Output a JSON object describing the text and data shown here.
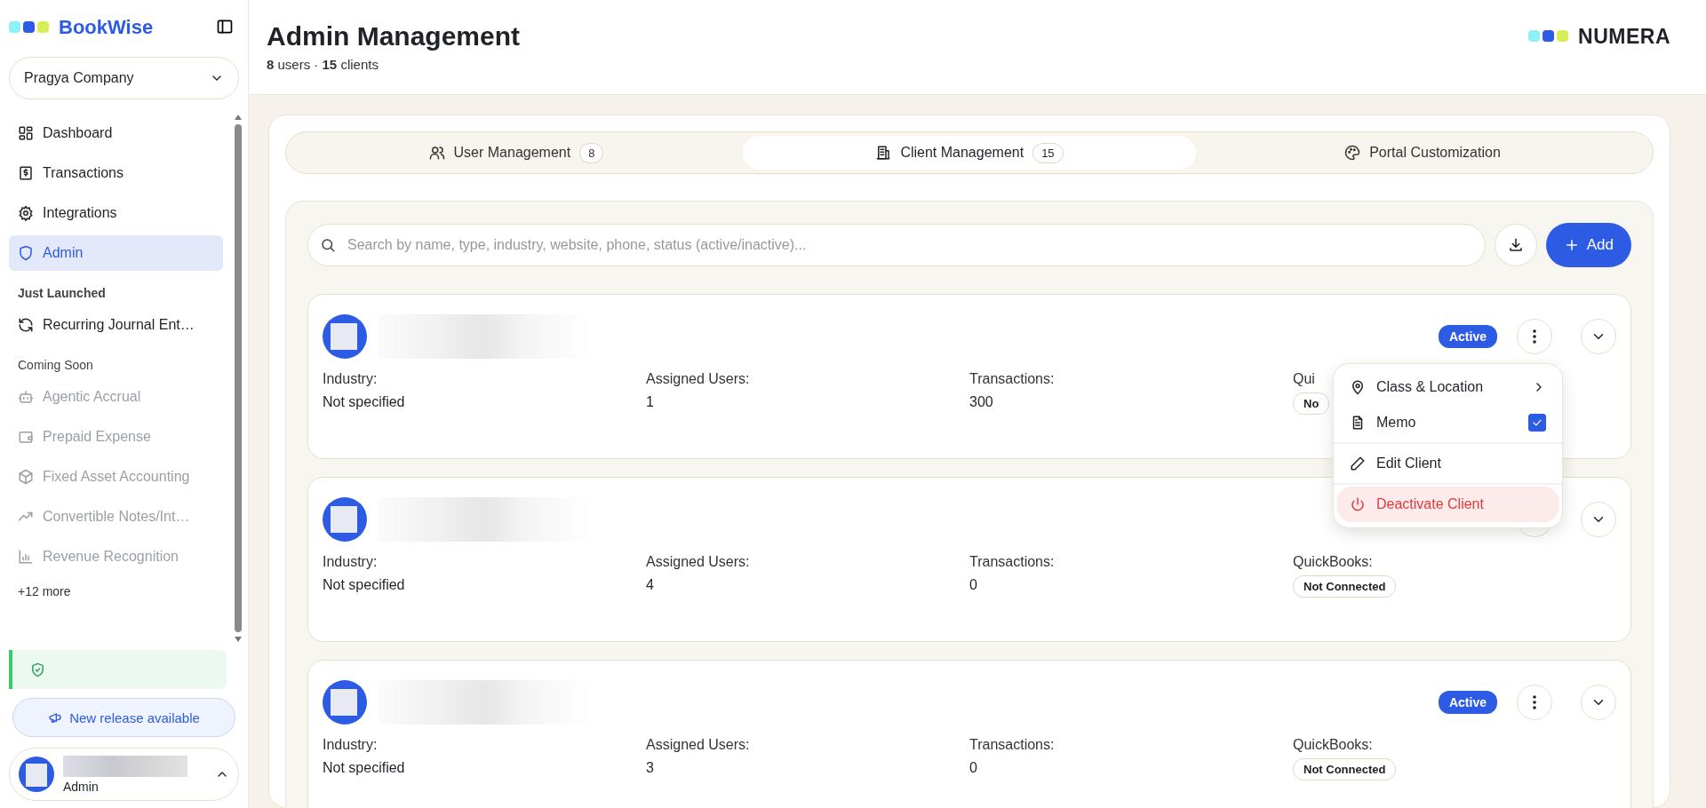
{
  "sidebar": {
    "brand": "BookWise",
    "company": "Pragya Company",
    "sections": [
      {
        "kind": "main",
        "items": [
          {
            "label": "Dashboard",
            "selected": false,
            "disabled": false
          },
          {
            "label": "Transactions",
            "selected": false,
            "disabled": false
          },
          {
            "label": "Integrations",
            "selected": false,
            "disabled": false
          },
          {
            "label": "Admin",
            "selected": true,
            "disabled": false
          }
        ]
      },
      {
        "kind": "launched",
        "title": "Just Launched",
        "items": [
          {
            "label": "Recurring Journal Ent…",
            "selected": false,
            "disabled": false
          }
        ]
      },
      {
        "kind": "soon",
        "title": "Coming Soon",
        "items": [
          {
            "label": "Agentic Accrual",
            "selected": false,
            "disabled": true
          },
          {
            "label": "Prepaid Expense",
            "selected": false,
            "disabled": true
          },
          {
            "label": "Fixed Asset Accounting",
            "selected": false,
            "disabled": true
          },
          {
            "label": "Convertible Notes/Int…",
            "selected": false,
            "disabled": true
          },
          {
            "label": "Revenue Recognition",
            "selected": false,
            "disabled": true
          }
        ]
      }
    ],
    "more": "+12 more",
    "release_button": "New release available",
    "user": {
      "role": "Admin"
    }
  },
  "header": {
    "title": "Admin Management",
    "subtitle": "**8** users · **15** clients",
    "logo": "NUMERA"
  },
  "tabs": [
    {
      "label": "User Management",
      "count": "8",
      "selected": false
    },
    {
      "label": "Client Management",
      "count": "15",
      "selected": true
    },
    {
      "label": "Portal Customization",
      "selected": false
    }
  ],
  "search": {
    "placeholder": "Search by name, type, industry, website, phone, status (active/inactive)..."
  },
  "add_button": "Add",
  "clients": [
    {
      "status": "Active",
      "fields": [
        {
          "kind": "text",
          "label": "Industry:",
          "value": "Not specified"
        },
        {
          "kind": "text",
          "label": "Assigned Users:",
          "value": "1"
        },
        {
          "kind": "text",
          "label": "Transactions:",
          "value": "300"
        },
        {
          "kind": "pill",
          "label": "Qui",
          "value": "No"
        }
      ]
    },
    {
      "fields": [
        {
          "kind": "text",
          "label": "Industry:",
          "value": "Not specified"
        },
        {
          "kind": "text",
          "label": "Assigned Users:",
          "value": "4"
        },
        {
          "kind": "text",
          "label": "Transactions:",
          "value": "0"
        },
        {
          "kind": "pill",
          "label": "QuickBooks:",
          "value": "Not Connected"
        }
      ]
    },
    {
      "status": "Active",
      "fields": [
        {
          "kind": "text",
          "label": "Industry:",
          "value": "Not specified"
        },
        {
          "kind": "text",
          "label": "Assigned Users:",
          "value": "3"
        },
        {
          "kind": "text",
          "label": "Transactions:",
          "value": "0"
        },
        {
          "kind": "pill",
          "label": "QuickBooks:",
          "value": "Not Connected"
        }
      ]
    }
  ],
  "context_menu": {
    "groups": [
      [
        {
          "kind": "submenu",
          "label": "Class & Location"
        },
        {
          "kind": "checkbox",
          "label": "Memo",
          "checked": true
        }
      ],
      [
        {
          "kind": "action",
          "label": "Edit Client"
        }
      ],
      [
        {
          "kind": "danger",
          "label": "Deactivate Client"
        }
      ]
    ]
  }
}
